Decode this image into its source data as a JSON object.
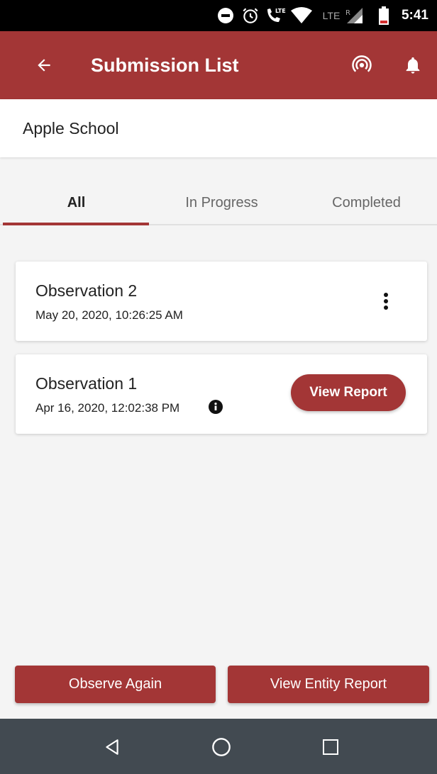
{
  "status_bar": {
    "time": "5:41",
    "lte_label": "LTE",
    "roaming_label": "R",
    "icons": [
      "do-not-disturb-icon",
      "alarm-icon",
      "volte-call-icon",
      "wifi-icon",
      "mobile-signal-icon",
      "battery-low-icon"
    ]
  },
  "app_bar": {
    "title": "Submission List",
    "color": "#a33636",
    "icons": [
      "back-arrow-icon",
      "broadcast-icon",
      "bell-icon"
    ]
  },
  "entity": {
    "name": "Apple School"
  },
  "tabs": [
    {
      "label": "All",
      "active": true
    },
    {
      "label": "In Progress",
      "active": false
    },
    {
      "label": "Completed",
      "active": false
    }
  ],
  "submissions": [
    {
      "title": "Observation 2",
      "date": "May 20, 2020, 10:26:25 AM",
      "action": "more-options-icon"
    },
    {
      "title": "Observation 1",
      "date": "Apr 16, 2020, 12:02:38 PM",
      "action_label": "View Report",
      "icon": "info-icon"
    }
  ],
  "footer": {
    "observe_again_label": "Observe Again",
    "view_entity_report_label": "View Entity Report"
  },
  "nav_bar": {
    "icons": [
      "nav-back-icon",
      "nav-home-icon",
      "nav-recents-icon"
    ]
  }
}
